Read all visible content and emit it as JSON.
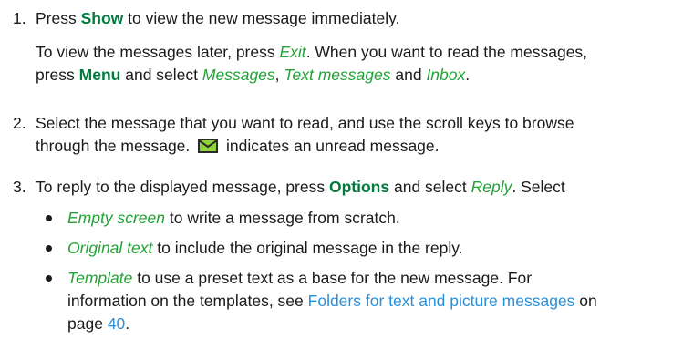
{
  "step1": {
    "number": "1.",
    "press": "Press",
    "show": "Show",
    "rest": "to view the new message immediately.",
    "later_a": "To view the messages later, press",
    "exit": "Exit",
    "later_b": ". When you want to read the messages,",
    "press2": "press",
    "menu": "Menu",
    "and_select": "and select",
    "messages": "Messages",
    "comma": ",",
    "text_messages": "Text messages",
    "and": "and",
    "inbox": "Inbox",
    "period": "."
  },
  "step2": {
    "number": "2.",
    "line1": "Select the message that you want to read, and use the scroll keys to browse",
    "line2a": "through the message.",
    "icon": "unread-envelope-icon",
    "line2b": "indicates an unread message."
  },
  "step3": {
    "number": "3.",
    "a": "To reply to the displayed message, press",
    "options": "Options",
    "b": "and select",
    "reply": "Reply",
    "c": ". Select"
  },
  "bullets": {
    "b1_opt": "Empty screen",
    "b1_text": "to write a message from scratch.",
    "b2_opt": "Original text",
    "b2_text": "to include the original message in the reply.",
    "b3_opt": "Template",
    "b3_text1": "to use a preset text as a base for the new message. For",
    "b3_text2": "information on the templates, see",
    "b3_link": "Folders for text and picture messages",
    "b3_text3": "on",
    "b3_text4": "page",
    "b3_page": "40",
    "b3_end": "."
  },
  "colors": {
    "ui_label": "#007a3d",
    "option": "#21a336",
    "link": "#2a8fd9",
    "icon_fill": "#8fd43a"
  }
}
